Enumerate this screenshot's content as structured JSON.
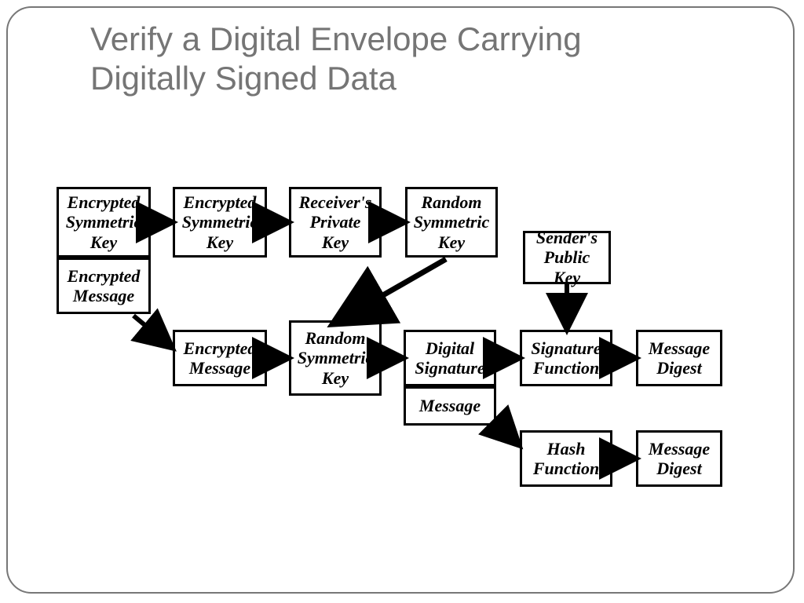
{
  "title": "Verify a Digital Envelope Carrying Digitally Signed Data",
  "boxes": {
    "esk1": "Encrypted Symmetric Key",
    "esk2": "Encrypted Symmetric Key",
    "rpk": "Receiver's Private Key",
    "rsk1": "Random Symmetric Key",
    "spk": "Sender's Public Key",
    "em1": "Encrypted Message",
    "em2": "Encrypted Message",
    "rsk2": "Random Symmetric Key",
    "ds": "Digital Signature",
    "sf": "Signature Function",
    "md1": "Message Digest",
    "msg": "Message",
    "hf": "Hash Function",
    "md2": "Message Digest"
  }
}
